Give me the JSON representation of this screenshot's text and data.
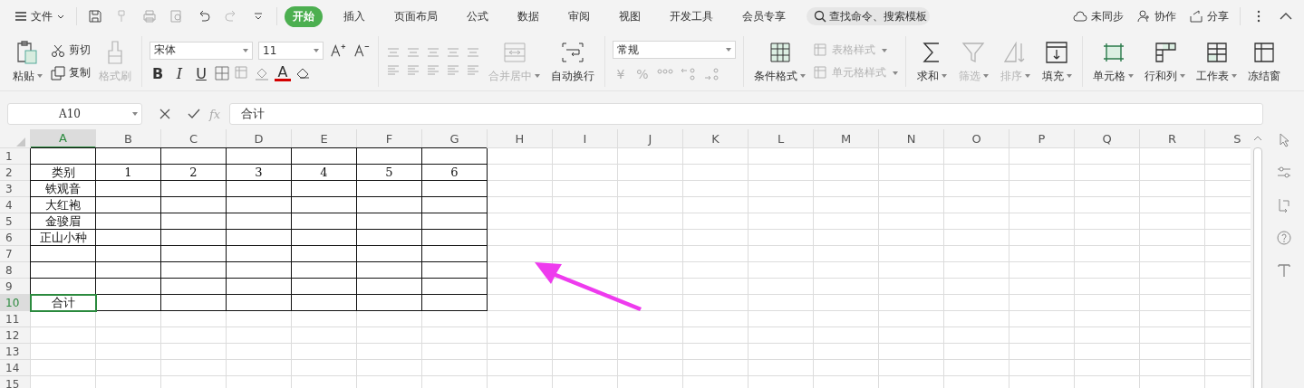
{
  "menubar": {
    "file_menu": "文件",
    "tabs": [
      {
        "label": "开始",
        "selected": true
      },
      {
        "label": "插入",
        "selected": false
      },
      {
        "label": "页面布局",
        "selected": false
      },
      {
        "label": "公式",
        "selected": false
      },
      {
        "label": "数据",
        "selected": false
      },
      {
        "label": "审阅",
        "selected": false
      },
      {
        "label": "视图",
        "selected": false
      },
      {
        "label": "开发工具",
        "selected": false
      },
      {
        "label": "会员专享",
        "selected": false
      }
    ],
    "search": {
      "placeholder": "查找命令、搜索模板"
    },
    "actions": [
      {
        "label": "未同步"
      },
      {
        "label": "协作"
      },
      {
        "label": "分享"
      }
    ]
  },
  "ribbon": {
    "paste": {
      "label": "粘贴",
      "disabled": false
    },
    "clipboard": [
      {
        "label": "剪切",
        "disabled": false
      },
      {
        "label": "复制",
        "disabled": false
      },
      {
        "label": "格式刷",
        "disabled": true
      }
    ],
    "font": {
      "name": "宋体",
      "size": "11",
      "bold": "B",
      "italic": "I",
      "underline": "U",
      "color_letter": "A"
    },
    "merge": {
      "label": "合并居中",
      "disabled": true
    },
    "wrap": {
      "label": "自动换行",
      "disabled": false
    },
    "number": {
      "format": "常规",
      "symbols": [
        {
          "label": "¥",
          "disabled": true
        },
        {
          "label": "%",
          "disabled": true
        }
      ]
    },
    "conditional": {
      "label": "条件格式",
      "disabled": false
    },
    "styles": [
      {
        "label": "表格样式",
        "disabled": true
      },
      {
        "label": "单元格样式",
        "disabled": true
      }
    ],
    "editing": [
      {
        "label": "求和",
        "disabled": false
      },
      {
        "label": "筛选",
        "disabled": true
      },
      {
        "label": "排序",
        "disabled": true
      },
      {
        "label": "填充",
        "disabled": false
      }
    ],
    "cells": [
      {
        "label": "单元格",
        "disabled": false
      },
      {
        "label": "行和列",
        "disabled": false
      },
      {
        "label": "工作表",
        "disabled": false
      },
      {
        "label": "冻结窗",
        "disabled": false
      }
    ]
  },
  "formula_bar": {
    "name_box": "A10",
    "function_label": "fx",
    "value": "合计"
  },
  "sheet": {
    "columns": [
      {
        "label": "A",
        "selected": true
      },
      {
        "label": "B",
        "selected": false
      },
      {
        "label": "C",
        "selected": false
      },
      {
        "label": "D",
        "selected": false
      },
      {
        "label": "E",
        "selected": false
      },
      {
        "label": "F",
        "selected": false
      },
      {
        "label": "G",
        "selected": false
      },
      {
        "label": "H",
        "selected": false
      },
      {
        "label": "I",
        "selected": false
      },
      {
        "label": "J",
        "selected": false
      },
      {
        "label": "K",
        "selected": false
      },
      {
        "label": "L",
        "selected": false
      },
      {
        "label": "M",
        "selected": false
      },
      {
        "label": "N",
        "selected": false
      },
      {
        "label": "O",
        "selected": false
      },
      {
        "label": "P",
        "selected": false
      },
      {
        "label": "Q",
        "selected": false
      },
      {
        "label": "R",
        "selected": false
      },
      {
        "label": "S",
        "selected": false
      }
    ],
    "rows": [
      {
        "label": "1",
        "selected": false,
        "cells": [
          {
            "bordered": true
          },
          {
            "bordered": true
          },
          {
            "bordered": true
          },
          {
            "bordered": true
          },
          {
            "bordered": true
          },
          {
            "bordered": true
          },
          {
            "bordered": true
          }
        ]
      },
      {
        "label": "2",
        "selected": false,
        "cells": [
          {
            "text": "类别",
            "bordered": true
          },
          {
            "text": "1",
            "bordered": true
          },
          {
            "text": "2",
            "bordered": true
          },
          {
            "text": "3",
            "bordered": true
          },
          {
            "text": "4",
            "bordered": true
          },
          {
            "text": "5",
            "bordered": true
          },
          {
            "text": "6",
            "bordered": true
          }
        ]
      },
      {
        "label": "3",
        "selected": false,
        "cells": [
          {
            "text": "铁观音",
            "bordered": true
          },
          {
            "bordered": true
          },
          {
            "bordered": true
          },
          {
            "bordered": true
          },
          {
            "bordered": true
          },
          {
            "bordered": true
          },
          {
            "bordered": true
          }
        ]
      },
      {
        "label": "4",
        "selected": false,
        "cells": [
          {
            "text": "大红袍",
            "bordered": true
          },
          {
            "bordered": true
          },
          {
            "bordered": true
          },
          {
            "bordered": true
          },
          {
            "bordered": true
          },
          {
            "bordered": true
          },
          {
            "bordered": true
          }
        ]
      },
      {
        "label": "5",
        "selected": false,
        "cells": [
          {
            "text": "金骏眉",
            "bordered": true
          },
          {
            "bordered": true
          },
          {
            "bordered": true
          },
          {
            "bordered": true
          },
          {
            "bordered": true
          },
          {
            "bordered": true
          },
          {
            "bordered": true
          }
        ]
      },
      {
        "label": "6",
        "selected": false,
        "cells": [
          {
            "text": "正山小种",
            "bordered": true
          },
          {
            "bordered": true
          },
          {
            "bordered": true
          },
          {
            "bordered": true
          },
          {
            "bordered": true
          },
          {
            "bordered": true
          },
          {
            "bordered": true
          }
        ]
      },
      {
        "label": "7",
        "selected": false,
        "cells": [
          {
            "bordered": true
          },
          {
            "bordered": true
          },
          {
            "bordered": true
          },
          {
            "bordered": true
          },
          {
            "bordered": true
          },
          {
            "bordered": true
          },
          {
            "bordered": true
          }
        ]
      },
      {
        "label": "8",
        "selected": false,
        "cells": [
          {
            "bordered": true
          },
          {
            "bordered": true
          },
          {
            "bordered": true
          },
          {
            "bordered": true
          },
          {
            "bordered": true
          },
          {
            "bordered": true
          },
          {
            "bordered": true
          }
        ]
      },
      {
        "label": "9",
        "selected": false,
        "cells": [
          {
            "bordered": true
          },
          {
            "bordered": true
          },
          {
            "bordered": true
          },
          {
            "bordered": true
          },
          {
            "bordered": true
          },
          {
            "bordered": true
          },
          {
            "bordered": true
          }
        ]
      },
      {
        "label": "10",
        "selected": true,
        "cells": [
          {
            "text": "合计",
            "bordered": true
          },
          {
            "bordered": true
          },
          {
            "bordered": true
          },
          {
            "bordered": true
          },
          {
            "bordered": true
          },
          {
            "bordered": true
          },
          {
            "bordered": true
          }
        ]
      },
      {
        "label": "11",
        "selected": false
      },
      {
        "label": "12",
        "selected": false
      },
      {
        "label": "13",
        "selected": false
      },
      {
        "label": "14",
        "selected": false
      },
      {
        "label": "15",
        "selected": false
      }
    ]
  }
}
